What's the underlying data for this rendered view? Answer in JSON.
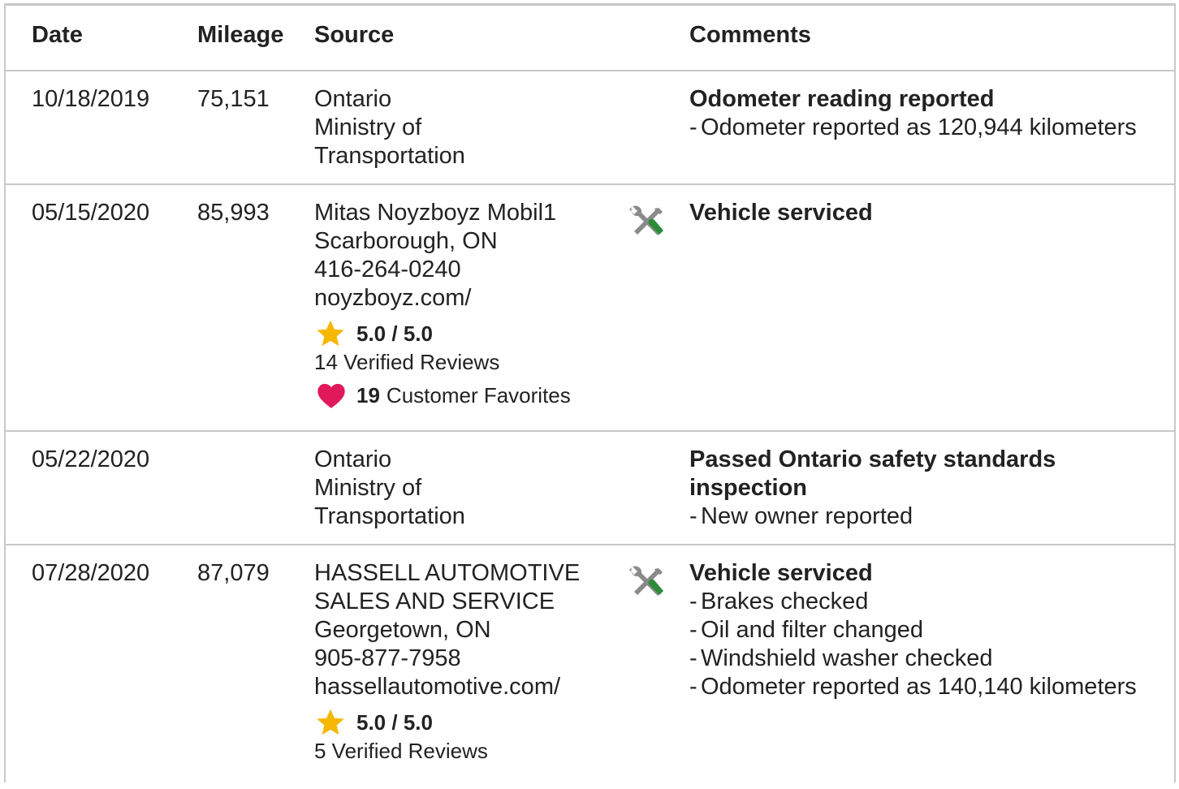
{
  "header": {
    "date": "Date",
    "mileage": "Mileage",
    "source": "Source",
    "comments": "Comments"
  },
  "rows": [
    {
      "date": "10/18/2019",
      "mileage": "75,151",
      "source_lines": [
        "Ontario",
        "Ministry of",
        "Transportation"
      ],
      "comment_title": "Odometer reading reported",
      "comment_bullets": [
        "Odometer reported as 120,944 kilometers"
      ]
    },
    {
      "date": "05/15/2020",
      "mileage": "85,993",
      "source_lines": [
        "Mitas Noyzboyz Mobil1",
        "Scarborough, ON",
        "416-264-0240",
        "noyzboyz.com/"
      ],
      "rating": "5.0 / 5.0",
      "reviews": "14 Verified Reviews",
      "favorites_count": "19",
      "favorites_label": "Customer Favorites",
      "icon": "tools-icon",
      "comment_title": "Vehicle serviced"
    },
    {
      "date": "05/22/2020",
      "mileage": "",
      "source_lines": [
        "Ontario",
        "Ministry of",
        "Transportation"
      ],
      "comment_title_lines": [
        "Passed Ontario safety standards",
        "inspection"
      ],
      "comment_bullets": [
        "New owner reported"
      ]
    },
    {
      "date": "07/28/2020",
      "mileage": "87,079",
      "source_lines": [
        "HASSELL AUTOMOTIVE",
        "SALES AND SERVICE",
        "Georgetown, ON",
        "905-877-7958",
        "hassellautomotive.com/"
      ],
      "rating": "5.0 / 5.0",
      "reviews": "5 Verified Reviews",
      "icon": "tools-icon",
      "comment_title": "Vehicle serviced",
      "comment_bullets": [
        "Brakes checked",
        "Oil and filter changed",
        "Windshield washer checked",
        "Odometer reported as 140,140 kilometers"
      ]
    }
  ],
  "colors": {
    "border": "#c8c8c8",
    "text": "#222222",
    "star": "#f5b700",
    "heart": "#e0195b",
    "tool_gray": "#8a8a8a",
    "tool_green": "#2e8b3a"
  }
}
